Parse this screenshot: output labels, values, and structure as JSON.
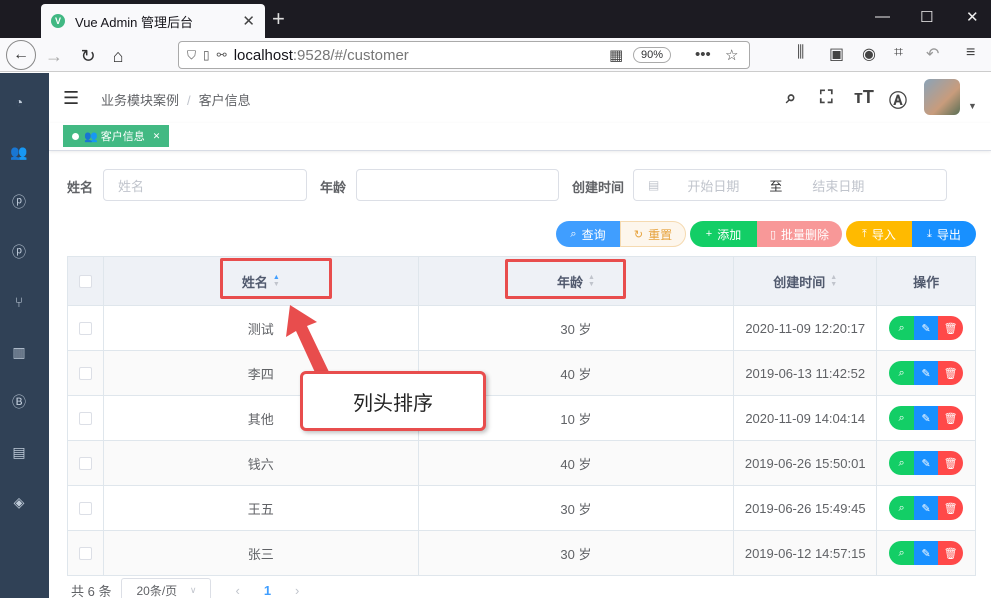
{
  "browser": {
    "tab_title": "Vue Admin 管理后台",
    "url_host": "localhost",
    "url_rest": ":9528/#/customer",
    "zoom": "90%"
  },
  "header": {
    "breadcrumb": [
      "业务模块案例",
      "客户信息"
    ]
  },
  "tags": [
    {
      "label": "客户信息"
    }
  ],
  "filter": {
    "name_label": "姓名",
    "name_placeholder": "姓名",
    "age_label": "年龄",
    "time_label": "创建时间",
    "start_placeholder": "开始日期",
    "range_sep": "至",
    "end_placeholder": "结束日期"
  },
  "buttons": {
    "search": "查询",
    "reset": "重置",
    "add": "添加",
    "batch_delete": "批量删除",
    "import": "导入",
    "export": "导出"
  },
  "table": {
    "columns": [
      "姓名",
      "年龄",
      "创建时间",
      "操作"
    ],
    "rows": [
      {
        "name": "测试",
        "age": "30 岁",
        "created": "2020-11-09 12:20:17"
      },
      {
        "name": "李四",
        "age": "40 岁",
        "created": "2019-06-13 11:42:52"
      },
      {
        "name": "其他",
        "age": "10 岁",
        "created": "2020-11-09 14:04:14"
      },
      {
        "name": "钱六",
        "age": "40 岁",
        "created": "2019-06-26 15:50:01"
      },
      {
        "name": "王五",
        "age": "30 岁",
        "created": "2019-06-26 15:49:45"
      },
      {
        "name": "张三",
        "age": "30 岁",
        "created": "2019-06-12 14:57:15"
      }
    ]
  },
  "pagination": {
    "total": "共 6 条",
    "page_size": "20条/页",
    "current": "1"
  },
  "annotation": {
    "callout": "列头排序"
  },
  "colors": {
    "sidebar": "#304156",
    "primary": "#409eff",
    "success": "#13ce66",
    "danger": "#ff4949",
    "highlight": "#e84d4d"
  }
}
